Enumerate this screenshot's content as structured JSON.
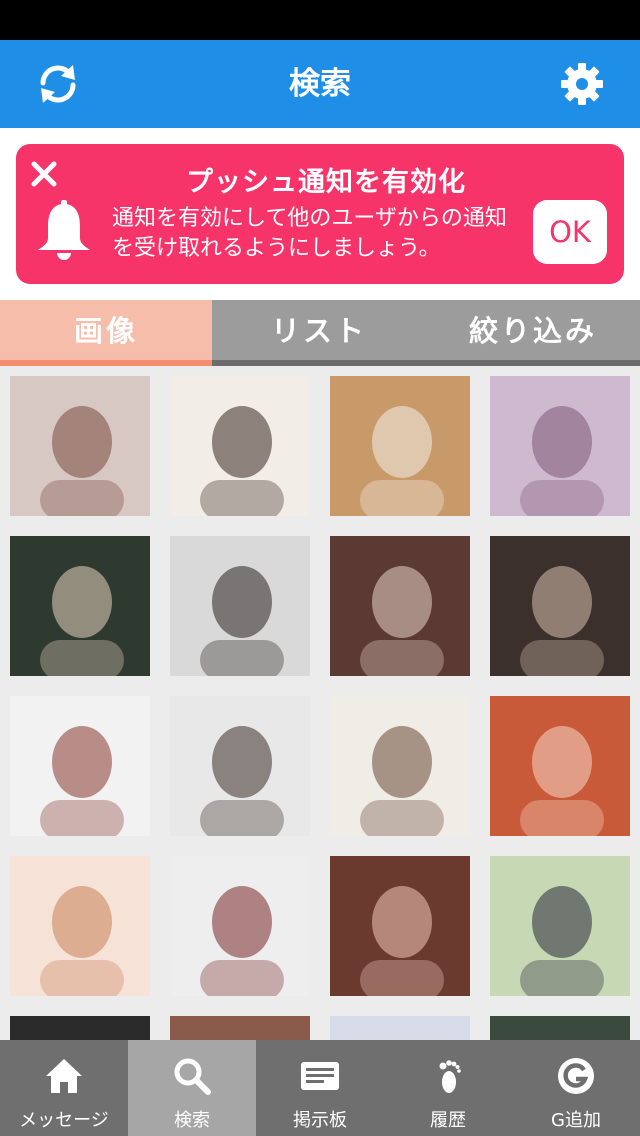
{
  "header": {
    "title": "検索",
    "refresh_icon": "refresh-icon",
    "settings_icon": "gear-icon"
  },
  "banner": {
    "title": "プッシュ通知を有効化",
    "message_line1": "通知を有効にして他のユーザからの通知",
    "message_line2": "を受け取れるようにしましょう。",
    "ok_label": "OK",
    "close_icon": "close-icon",
    "bell_icon": "bell-icon",
    "background": "#f7346a"
  },
  "tabs": [
    {
      "label": "画像",
      "selected": true
    },
    {
      "label": "リスト",
      "selected": false
    },
    {
      "label": "絞り込み",
      "selected": false
    }
  ],
  "tabbar": [
    {
      "label": "メッセージ",
      "icon": "home-icon",
      "active": false
    },
    {
      "label": "検索",
      "icon": "search-icon",
      "active": true
    },
    {
      "label": "掲示板",
      "icon": "board-icon",
      "active": false
    },
    {
      "label": "履歴",
      "icon": "footprint-icon",
      "active": false
    },
    {
      "label": "G追加",
      "icon": "g-circle-icon",
      "active": false
    }
  ],
  "colors": {
    "nav": "#1f8ee6",
    "accent": "#f7346a",
    "tab_selected": "#f6bdaa"
  }
}
